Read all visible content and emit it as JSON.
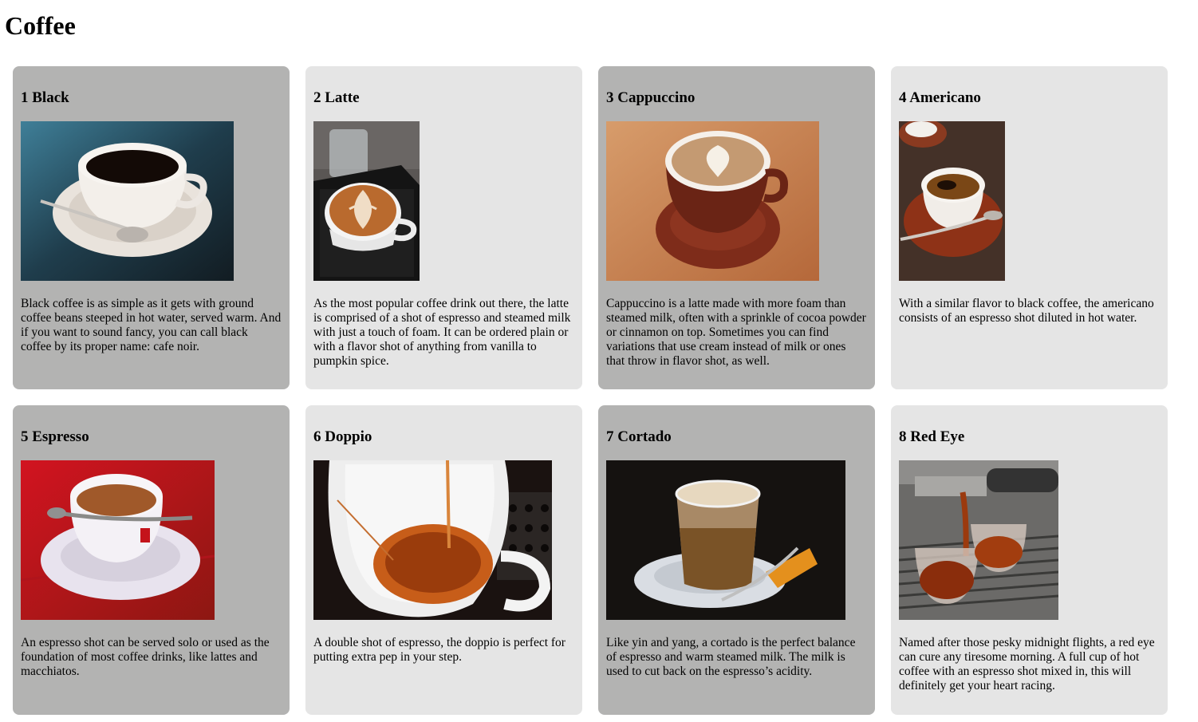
{
  "page": {
    "title": "Coffee"
  },
  "coffees": [
    {
      "name": "1 Black",
      "image": "black-coffee-cup-icon",
      "description": "Black coffee is as simple as it gets with ground coffee beans steeped in hot water, served warm. And if you want to sound fancy, you can call black coffee by its proper name: cafe noir."
    },
    {
      "name": "2 Latte",
      "image": "latte-art-cup-icon",
      "description": "As the most popular coffee drink out there, the latte is comprised of a shot of espresso and steamed milk with just a touch of foam. It can be ordered plain or with a flavor shot of anything from vanilla to pumpkin spice."
    },
    {
      "name": "3 Cappuccino",
      "image": "cappuccino-cup-icon",
      "description": "Cappuccino is a latte made with more foam than steamed milk, often with a sprinkle of cocoa powder or cinnamon on top. Sometimes you can find variations that use cream instead of milk or ones that throw in flavor shot, as well."
    },
    {
      "name": "4 Americano",
      "image": "americano-cup-icon",
      "description": "With a similar flavor to black coffee, the americano consists of an espresso shot diluted in hot water."
    },
    {
      "name": "5 Espresso",
      "image": "espresso-cup-icon",
      "description": "An espresso shot can be served solo or used as the foundation of most coffee drinks, like lattes and macchiatos."
    },
    {
      "name": "6 Doppio",
      "image": "doppio-pour-icon",
      "description": "A double shot of espresso, the doppio is perfect for putting extra pep in your step."
    },
    {
      "name": "7 Cortado",
      "image": "cortado-glass-icon",
      "description": "Like yin and yang, a cortado is the perfect balance of espresso and warm steamed milk. The milk is used to cut back on the espresso’s acidity."
    },
    {
      "name": "8 Red Eye",
      "image": "red-eye-machine-icon",
      "description": "Named after those pesky midnight flights, a red eye can cure any tiresome morning. A full cup of hot coffee with an espresso shot mixed in, this will definitely get your heart racing."
    }
  ],
  "colors": {
    "card_dark": "#b3b3b2",
    "card_light": "#e5e5e5"
  }
}
